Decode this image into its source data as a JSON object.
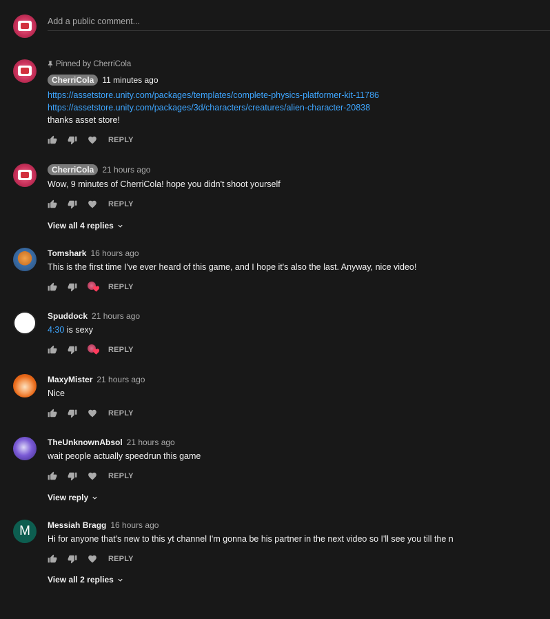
{
  "comment_box": {
    "placeholder": "Add a public comment..."
  },
  "pinned_label": "Pinned by CherriCola",
  "reply_label": "REPLY",
  "comments": [
    {
      "author": "CherriCola",
      "time": "11 minutes ago",
      "lines": [
        "https://assetstore.unity.com/packages/templates/complete-physics-platformer-kit-11786",
        "https://assetstore.unity.com/packages/3d/characters/creatures/alien-character-20838",
        "thanks asset store!"
      ]
    },
    {
      "author": "CherriCola",
      "time": "21 hours ago",
      "text": "Wow, 9 minutes of CherriCola! hope you didn't shoot yourself",
      "replies_label": "View all 4 replies"
    },
    {
      "author": "Tomshark",
      "time": "16 hours ago",
      "text": "This is the first time I've ever heard of this game, and I hope it's also the last. Anyway, nice video!"
    },
    {
      "author": "Spuddock",
      "time": "21 hours ago",
      "timestamp_link": "4:30",
      "text_after": " is sexy"
    },
    {
      "author": "MaxyMister",
      "time": "21 hours ago",
      "text": "Nice"
    },
    {
      "author": "TheUnknownAbsol",
      "time": "21 hours ago",
      "text": "wait people actually speedrun this game",
      "replies_label": "View reply"
    },
    {
      "author": "Messiah Bragg",
      "avatar_letter": "M",
      "time": "16 hours ago",
      "text": "Hi for anyone that's new to this yt channel I'm gonna be his partner in the next video so I'll see you till the n",
      "replies_label": "View all 2 replies"
    }
  ],
  "colors": {
    "background": "#181818",
    "link": "#3ea6ff",
    "secondary_text": "#aaaaaa",
    "heart": "#ff3b5c",
    "messiah_avatar": "#0d5e50"
  }
}
